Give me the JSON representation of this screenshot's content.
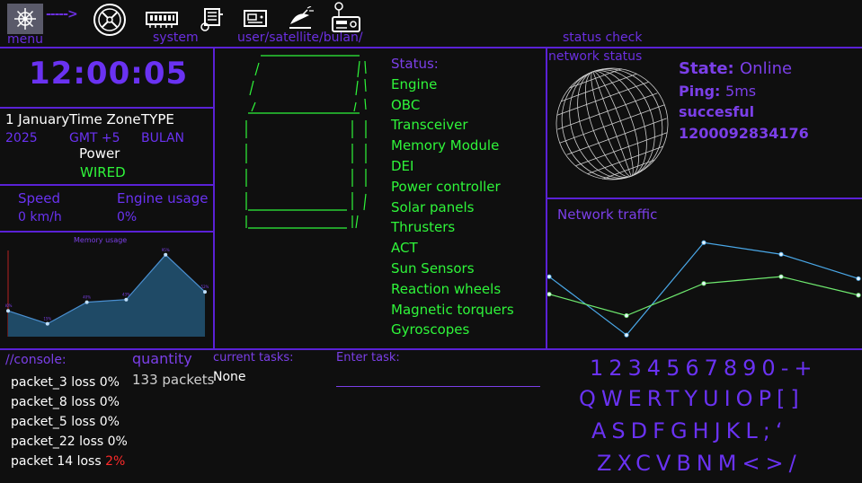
{
  "nav": {
    "menu_label": "menu",
    "system_label": "system",
    "path_label": "user/satellite/bulan/",
    "status_check_label": "status check",
    "arrow": "----->"
  },
  "clock": {
    "time": "12:00:05",
    "date_line1": "1 January",
    "date_line2": "2025",
    "timezone_label": "Time Zone",
    "timezone_value": "GMT +5",
    "type_label": "TYPE",
    "type_value": "BULAN",
    "power_label": "Power",
    "power_value": "WIRED"
  },
  "speed": {
    "speed_label": "Speed",
    "speed_value": "0 km/h",
    "engine_label": "Engine usage",
    "engine_value": "0%"
  },
  "memory_chart": {
    "title": "Memory usage"
  },
  "chart_data": [
    {
      "type": "area",
      "title": "Memory usage",
      "values": [
        30,
        15,
        40,
        43,
        95,
        52
      ],
      "ylim": [
        0,
        100
      ],
      "colors": {
        "fill": "#1f4a66",
        "line": "#4a8fd0"
      }
    },
    {
      "type": "line",
      "title": "Network traffic",
      "x": [
        0,
        1,
        2,
        3,
        4
      ],
      "series": [
        {
          "values": [
            70,
            10,
            105,
            93,
            68
          ],
          "color": "#4aa8e8"
        },
        {
          "values": [
            52,
            30,
            63,
            70,
            51
          ],
          "color": "#6ee86e"
        }
      ],
      "ylim": [
        0,
        120
      ]
    }
  ],
  "status": {
    "header": "Status:",
    "items": [
      "Engine",
      "OBC",
      "Transceiver",
      "Memory Module",
      "DEI",
      "Power controller",
      "Solar panels",
      "Thrusters",
      "ACT",
      "Sun Sensors",
      "Reaction wheels",
      "Magnetic torquers",
      "Gyroscopes"
    ]
  },
  "network": {
    "title": "network status",
    "state_label": "State:",
    "state_value": "Online",
    "ping_label": "Ping:",
    "ping_value": "5ms",
    "result": "succesful",
    "id": "1200092834176",
    "traffic_title": "Network traffic"
  },
  "console": {
    "title": "//console:",
    "packets": [
      {
        "text": "packet_3 loss 0%",
        "alert": ""
      },
      {
        "text": "packet_8 loss 0%",
        "alert": ""
      },
      {
        "text": "packet_5 loss 0%",
        "alert": ""
      },
      {
        "text": "packet_22 loss 0%",
        "alert": ""
      },
      {
        "text": "packet 14 loss ",
        "alert": "2%"
      }
    ],
    "quantity_label": "quantity",
    "quantity_value": "133 packets",
    "tasks_label": "current tasks:",
    "tasks_value": "None",
    "enter_task_label": "Enter task:",
    "enter_task_value": ""
  },
  "keyboard": {
    "row1": "1234567890-+",
    "row2": "QWERTYUIOP[]",
    "row3": "ASDFGHJKL;‘",
    "row4": "ZXCVBNM<>/"
  }
}
